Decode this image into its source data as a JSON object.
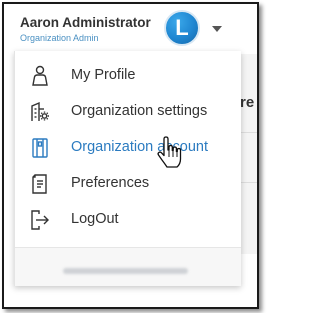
{
  "user": {
    "name": "Aaron Administrator",
    "role": "Organization Admin",
    "avatar_letter": "L"
  },
  "menu": {
    "items": [
      {
        "label": "My Profile",
        "icon": "person-icon",
        "active": false
      },
      {
        "label": "Organization settings",
        "icon": "building-gear-icon",
        "active": false
      },
      {
        "label": "Organization account",
        "icon": "book-icon",
        "active": true
      },
      {
        "label": "Preferences",
        "icon": "document-list-icon",
        "active": false
      },
      {
        "label": "LogOut",
        "icon": "logout-icon",
        "active": false
      }
    ]
  },
  "background": {
    "partial_text": "re"
  },
  "colors": {
    "accent": "#2b7bc0",
    "role_text": "#4a90c2",
    "avatar": "#1f86d1",
    "text": "#333333"
  }
}
